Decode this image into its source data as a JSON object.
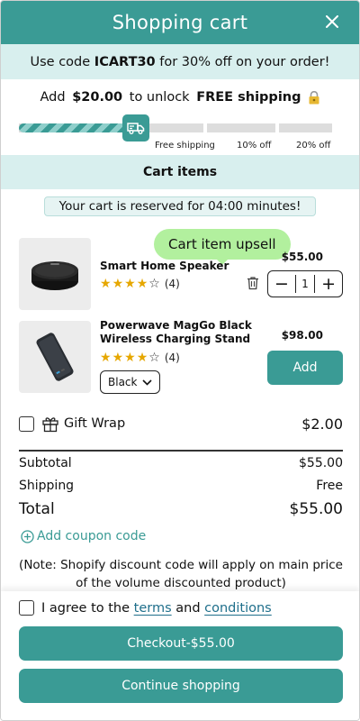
{
  "header": {
    "title": "Shopping cart",
    "close_icon": "close-icon"
  },
  "promo": {
    "prefix": "Use code ",
    "code": "ICART30",
    "suffix": " for 30% off on your order!"
  },
  "shipping_message": {
    "prefix": "Add ",
    "amount": "$20.00",
    "middle": " to unlock ",
    "reward": "FREE shipping",
    "icon": "lock-icon"
  },
  "progress": {
    "value": 0.37,
    "tiers": [
      "Free shipping",
      "10% off",
      "20% off"
    ],
    "badge_icon": "truck-icon"
  },
  "cart_section": {
    "title": "Cart items",
    "reservation": "Your cart is reserved for 04:00 minutes!"
  },
  "items": [
    {
      "name": "Smart Home Speaker",
      "rating": 4,
      "rating_count": "(4)",
      "price": "$55.00",
      "quantity": "1",
      "tooltip": "Cart item upsell"
    },
    {
      "name_line1": "Powerwave MagGo Black",
      "name_line2": "Wireless Charging Stand",
      "rating": 4,
      "rating_count": "(4)",
      "price": "$98.00",
      "variant": "Black",
      "add_label": "Add"
    }
  ],
  "gift_wrap": {
    "label": "Gift Wrap",
    "price": "$2.00",
    "icon": "gift-icon"
  },
  "summary": {
    "subtotal_label": "Subtotal",
    "subtotal": "$55.00",
    "shipping_label": "Shipping",
    "shipping": "Free",
    "total_label": "Total",
    "total": "$55.00"
  },
  "coupon": {
    "label": "Add coupon code",
    "icon": "plus-circle-icon"
  },
  "note": "(Note: Shopify discount code will apply on main price of the volume discounted product)",
  "footer": {
    "agree_prefix": "I agree to the ",
    "terms": "terms",
    "agree_and": " and ",
    "conditions": "conditions",
    "checkout_label": "Checkout-$55.00",
    "continue_label": "Continue shopping"
  },
  "colors": {
    "brand": "#3a9b95",
    "tint": "#d8efee",
    "tooltip": "#b2f09e",
    "star": "#e6a700",
    "link": "#1f6f8b"
  }
}
